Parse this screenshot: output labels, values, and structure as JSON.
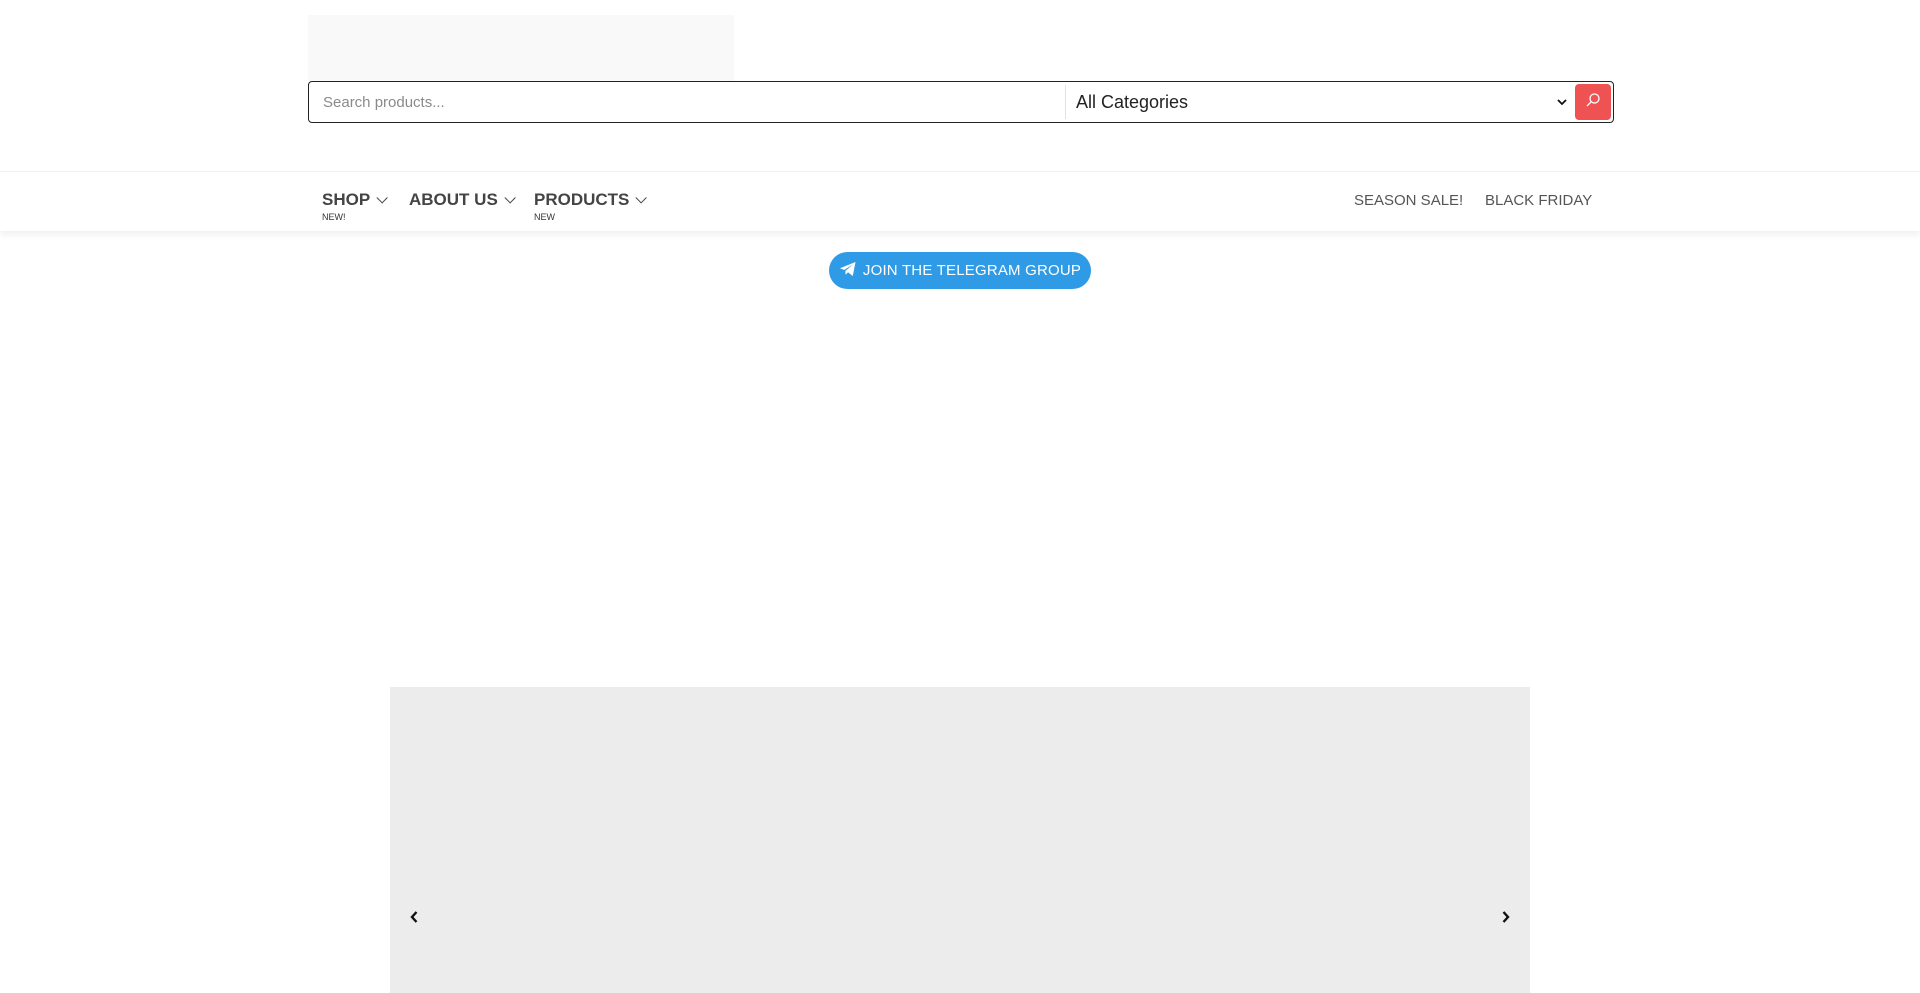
{
  "search": {
    "placeholder": "Search products...",
    "category_selected": "All Categories"
  },
  "nav": {
    "left": [
      {
        "label": "SHOP",
        "badge": "NEW!"
      },
      {
        "label": "ABOUT US",
        "badge": ""
      },
      {
        "label": "PRODUCTS",
        "badge": "NEW"
      }
    ],
    "right": [
      {
        "label": "SEASON SALE!"
      },
      {
        "label": "BLACK FRIDAY"
      }
    ]
  },
  "telegram": {
    "label": "JOIN THE TELEGRAM GROUP",
    "icon": "telegram-plane-icon",
    "color": "#2f9be6"
  },
  "colors": {
    "search_button": "#ef5252",
    "slider_bg": "#ececec"
  }
}
